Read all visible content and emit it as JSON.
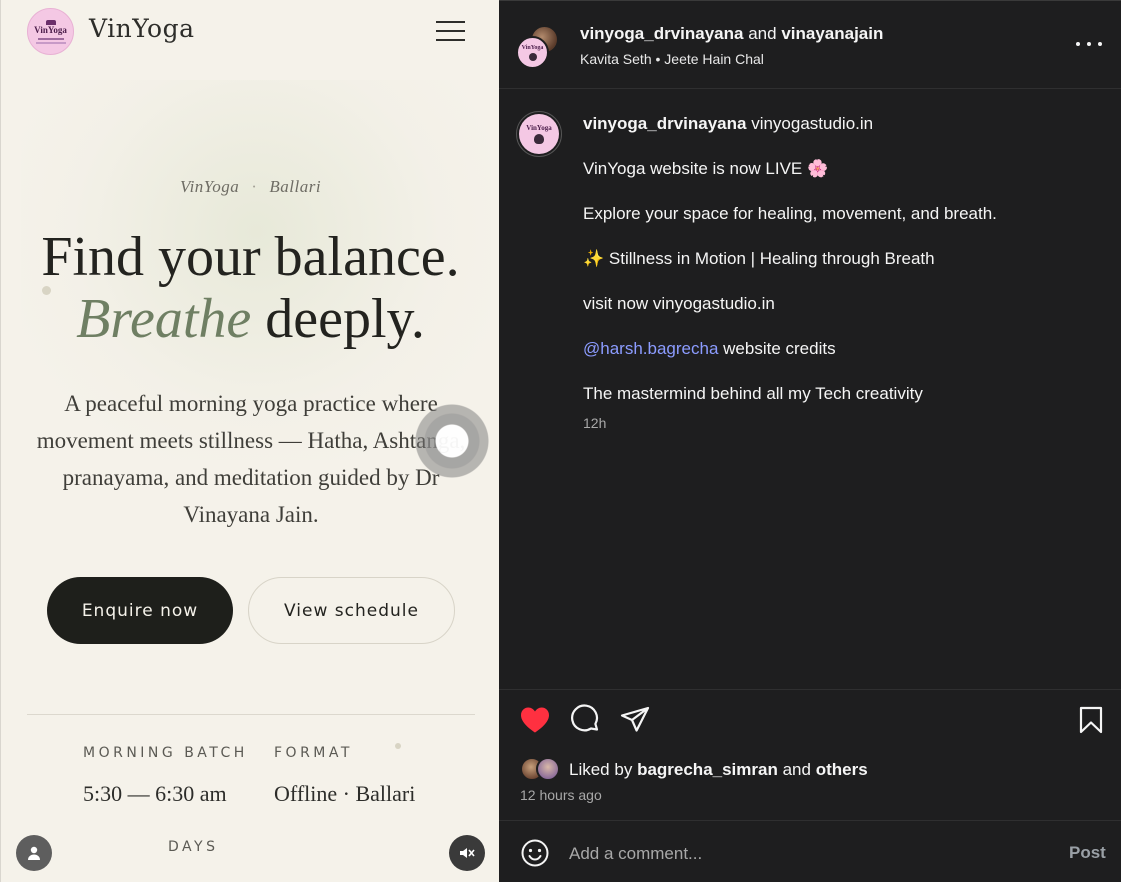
{
  "site": {
    "brand": "VinYoga",
    "logo_text": "VinYoga",
    "eyebrow": {
      "left": "VinYoga",
      "separator": "·",
      "right": "Ballari"
    },
    "headline": {
      "line1": "Find your balance.",
      "accent": "Breathe",
      "rest": "deeply."
    },
    "lede": "A peaceful morning yoga practice where movement meets stillness — Hatha, Ashtanga, pranayama, and meditation guided by Dr Vinayana Jain.",
    "primary_button": "Enquire now",
    "secondary_button": "View schedule",
    "details": [
      {
        "label": "MORNING BATCH",
        "value": "5:30 — 6:30 am"
      },
      {
        "label": "FORMAT",
        "value": "Offline · Ballari"
      },
      {
        "label": "DAYS",
        "value": ""
      }
    ]
  },
  "post": {
    "header": {
      "user1": "vinyoga_drvinayana",
      "joiner": "and",
      "user2": "vinayanajain",
      "audio": "Kavita Seth • Jeete Hain Chal"
    },
    "caption": {
      "username": "vinyoga_drvinayana",
      "first": "vinyogastudio.in",
      "lines": [
        "VinYoga website is now LIVE 🌸",
        "Explore your space for healing, movement, and breath.",
        "✨ Stillness in Motion | Healing through Breath",
        "visit now vinyogastudio.in"
      ],
      "mention": "@harsh.bagrecha",
      "mention_rest": "website credits",
      "last": "The mastermind behind all my Tech creativity",
      "time": "12h"
    },
    "likes": {
      "prefix": "Liked by",
      "user": "bagrecha_simran",
      "joiner": "and",
      "others": "others"
    },
    "posted_ago": "12 hours ago",
    "comment_placeholder": "Add a comment...",
    "post_label": "Post"
  },
  "colors": {
    "site_bg": "#f5f2ea",
    "accent_green": "#6f7f63",
    "dark_button": "#1e1f1b",
    "panel_bg": "#1e1e1f",
    "like_red": "#ff3040",
    "mention_blue": "#8c9cff"
  },
  "icons": [
    "hamburger-menu-icon",
    "more-options-icon",
    "heart-icon",
    "comment-icon",
    "share-icon",
    "bookmark-icon",
    "emoji-icon",
    "user-icon",
    "muted-audio-icon"
  ]
}
